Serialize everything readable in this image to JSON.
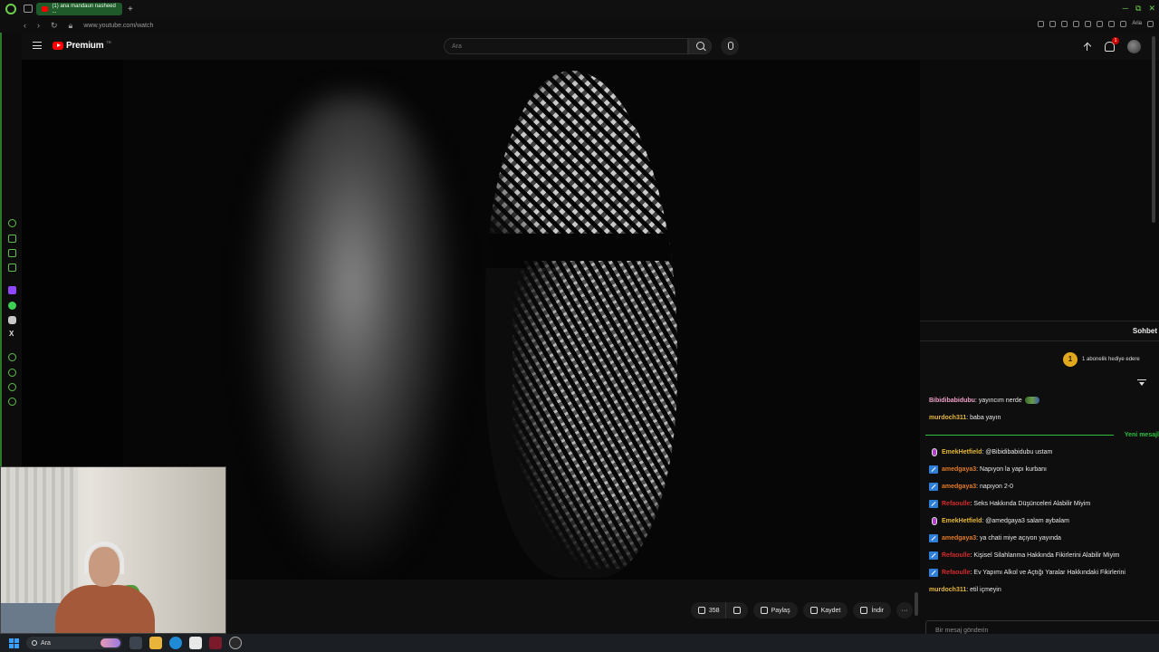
{
  "browser": {
    "tab_title": "(1) ana mandaun nasheed ...",
    "new_tab_label": "+",
    "url": "www.youtube.com/watch",
    "ai_label": "Aria",
    "window_controls": [
      "─",
      "⧉",
      "✕"
    ]
  },
  "youtube": {
    "brand": "Premium",
    "country_code": "TR",
    "search_placeholder": "Ara",
    "notification_count": "1"
  },
  "video_actions": {
    "like_count": "358",
    "share_label": "Paylaş",
    "save_label": "Kaydet",
    "download_label": "İndir"
  },
  "chat": {
    "title": "Sohbet",
    "gift_count": "1",
    "gift_text": "1 abonelik hediye edere",
    "new_messages_label": "Yeni mesajl",
    "input_placeholder": "Bir mesaj gönderin",
    "messages": [
      {
        "user": "Bibidibabidubu",
        "text": ": yayıncım nerde",
        "color": "#f0a0c8",
        "badge": "none",
        "emote": true
      },
      {
        "user": "murdoch311",
        "text": ": baba yayın",
        "color": "#e6b83a",
        "badge": "none",
        "emote": false
      },
      {
        "user": "EmekHetfield",
        "text": ": @Bibidibabidubu ustam",
        "color": "#e6b83a",
        "badge": "mic",
        "emote": false
      },
      {
        "user": "amedgaya3",
        "text": ": Napıyon la yapı kurbanı",
        "color": "#e07a2a",
        "badge": "blue",
        "emote": false
      },
      {
        "user": "amedgaya3",
        "text": ": napıyon 2-0",
        "color": "#e07a2a",
        "badge": "blue",
        "emote": false
      },
      {
        "user": "Refaoulle",
        "text": ": Seks Hakkında Düşünceleri Alabilir Miyim",
        "color": "#d42a2a",
        "badge": "blue",
        "emote": false
      },
      {
        "user": "EmekHetfield",
        "text": ": @amedgaya3 salam aybalam",
        "color": "#e6b83a",
        "badge": "mic",
        "emote": false
      },
      {
        "user": "amedgaya3",
        "text": ": ya chati miye açıyon yayında",
        "color": "#e07a2a",
        "badge": "blue",
        "emote": false
      },
      {
        "user": "Refaoulle",
        "text": ": Kişisel Silahlanma Hakkında Fikirlerini Alabilir Miyim",
        "color": "#d42a2a",
        "badge": "blue",
        "emote": false
      },
      {
        "user": "Refaoulle",
        "text": ": Ev Yapımı Alkol ve Açtığı Yaralar Hakkındaki Fikirlerini",
        "color": "#d42a2a",
        "badge": "blue",
        "emote": false
      },
      {
        "user": "murdoch311",
        "text": ": etil içmeyin",
        "color": "#e6b83a",
        "badge": "none",
        "emote": false
      }
    ]
  },
  "taskbar": {
    "search_label": "Ara"
  },
  "colors": {
    "opera_green": "#6ccf4d",
    "youtube_red": "#ff0000",
    "new_message_green": "#2fbf3f"
  }
}
